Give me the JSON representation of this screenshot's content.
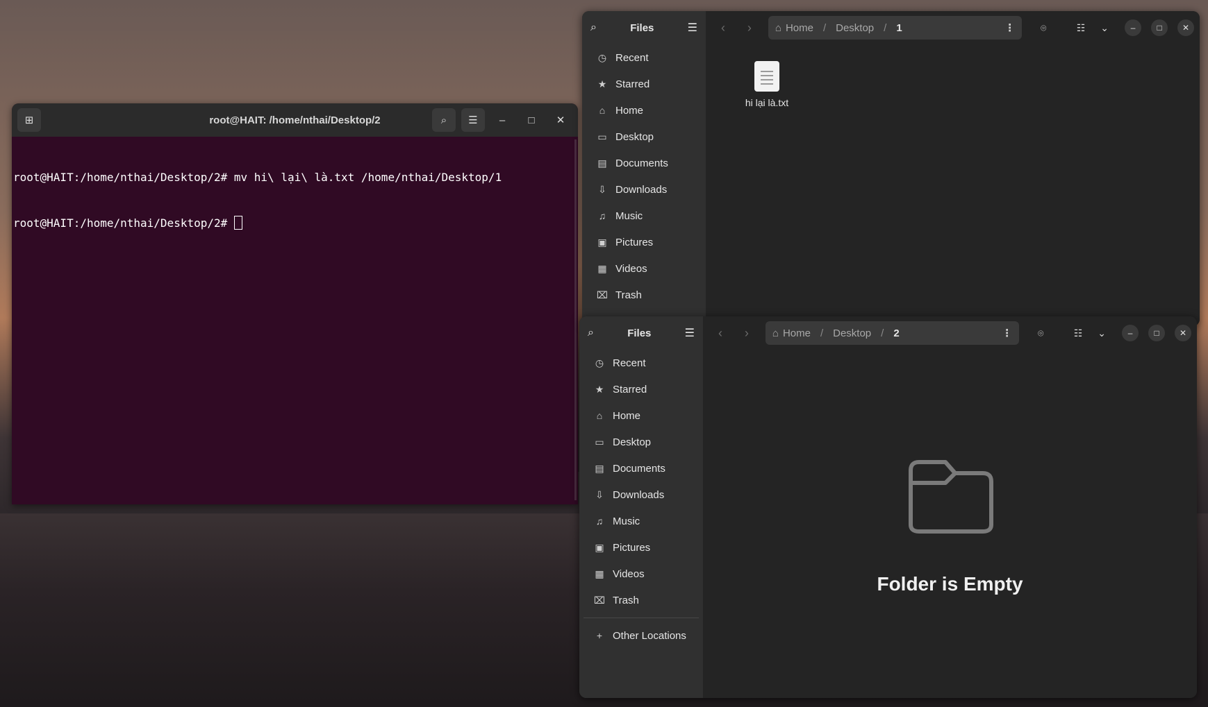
{
  "terminal": {
    "title": "root@HAIT: /home/nthai/Desktop/2",
    "lines": [
      "root@HAIT:/home/nthai/Desktop/2# mv hi\\ lại\\ là.txt /home/nthai/Desktop/1",
      "root@HAIT:/home/nthai/Desktop/2# "
    ]
  },
  "files_top": {
    "title": "Files",
    "sidebar": [
      "Recent",
      "Starred",
      "Home",
      "Desktop",
      "Documents",
      "Downloads",
      "Music",
      "Pictures",
      "Videos",
      "Trash"
    ],
    "path": [
      "Home",
      "Desktop",
      "1"
    ],
    "file": "hi lại là.txt"
  },
  "files_bottom": {
    "title": "Files",
    "sidebar": [
      "Recent",
      "Starred",
      "Home",
      "Desktop",
      "Documents",
      "Downloads",
      "Music",
      "Pictures",
      "Videos",
      "Trash"
    ],
    "other_locations": "Other Locations",
    "path": [
      "Home",
      "Desktop",
      "2"
    ],
    "empty_message": "Folder is Empty"
  }
}
